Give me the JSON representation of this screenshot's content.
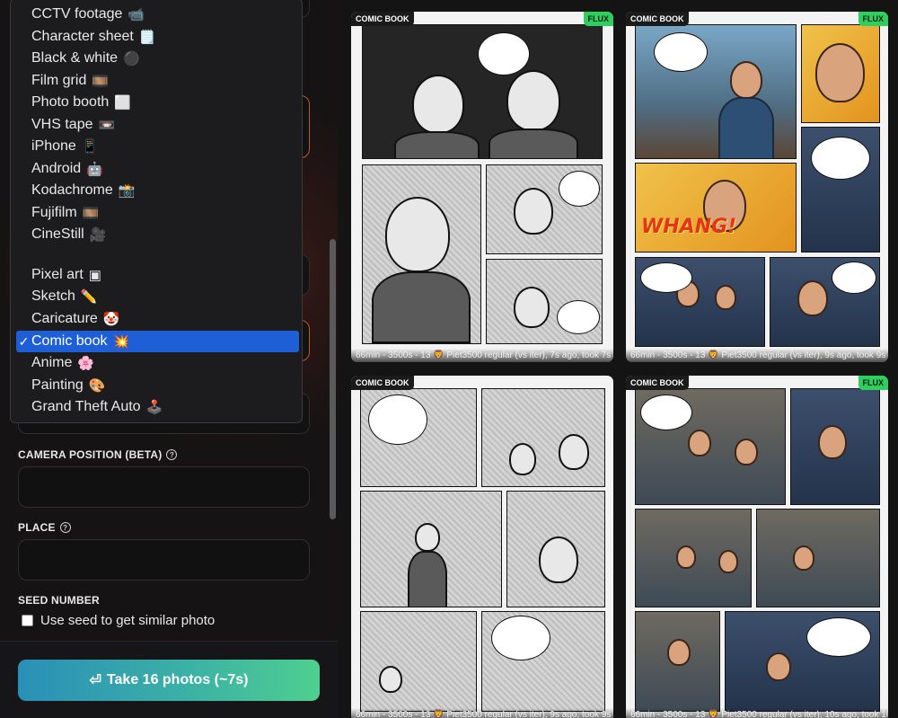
{
  "style_menu": {
    "items": [
      {
        "label": "CCTV footage",
        "emoji": "📹",
        "selected": false
      },
      {
        "label": "Character sheet",
        "emoji": "🗒️",
        "selected": false
      },
      {
        "label": "Black & white",
        "emoji": "⚫",
        "selected": false
      },
      {
        "label": "Film grid",
        "emoji": "🎞️",
        "selected": false
      },
      {
        "label": "Photo booth",
        "emoji": "⬜",
        "selected": false
      },
      {
        "label": "VHS tape",
        "emoji": "📼",
        "selected": false
      },
      {
        "label": "iPhone",
        "emoji": "📱",
        "selected": false
      },
      {
        "label": "Android",
        "emoji": "🤖",
        "selected": false
      },
      {
        "label": "Kodachrome",
        "emoji": "📸",
        "selected": false
      },
      {
        "label": "Fujifilm",
        "emoji": "🎞️",
        "selected": false
      },
      {
        "label": "CineStill",
        "emoji": "🎥",
        "selected": false
      },
      {
        "label": "Pixel art",
        "emoji": "▣",
        "selected": false
      },
      {
        "label": "Sketch",
        "emoji": "✏️",
        "selected": false
      },
      {
        "label": "Caricature",
        "emoji": "🤡",
        "selected": false
      },
      {
        "label": "Comic book",
        "emoji": "💥",
        "selected": true
      },
      {
        "label": "Anime",
        "emoji": "🌸",
        "selected": false
      },
      {
        "label": "Painting",
        "emoji": "🎨",
        "selected": false
      },
      {
        "label": "Grand Theft Auto",
        "emoji": "🕹️",
        "selected": false
      }
    ],
    "check_mark": "✓"
  },
  "settings": {
    "camera_position_label": "CAMERA POSITION (BETA)",
    "place_label": "PLACE",
    "seed_label": "SEED NUMBER",
    "seed_checkbox_label": "Use seed to get similar photo",
    "help_glyph": "?"
  },
  "actions": {
    "take_photos_label": "Take 16 photos (~7s)",
    "take_photos_icon": "⏎"
  },
  "gallery": {
    "cards": [
      {
        "style_tag": "COMIC BOOK",
        "model_tag": "FLUX",
        "caption": "66min - 3500s - 13 🦁 Piet3500 regular (vs iter), 7s ago, took 7s"
      },
      {
        "style_tag": "COMIC BOOK",
        "model_tag": "FLUX",
        "caption": "66min - 3500s - 13 🦁 Piet3500 regular (vs iter), 9s ago, took 9s"
      },
      {
        "style_tag": "COMIC BOOK",
        "model_tag": "FLUX",
        "caption": "66min - 3500s - 13 🦁 Piet3500 regular (vs iter), 9s ago, took 9s"
      },
      {
        "style_tag": "COMIC BOOK",
        "model_tag": "FLUX",
        "caption": "66min - 3500s - 13 🦁 Piet3500 regular (vs iter), 10s ago, took 10s"
      }
    ],
    "sound_effect": "WHANG!"
  },
  "colors": {
    "accent_selected": "#1f5fd6",
    "flux_badge": "#2fcf5f",
    "field_highlight": "#c2552b"
  }
}
